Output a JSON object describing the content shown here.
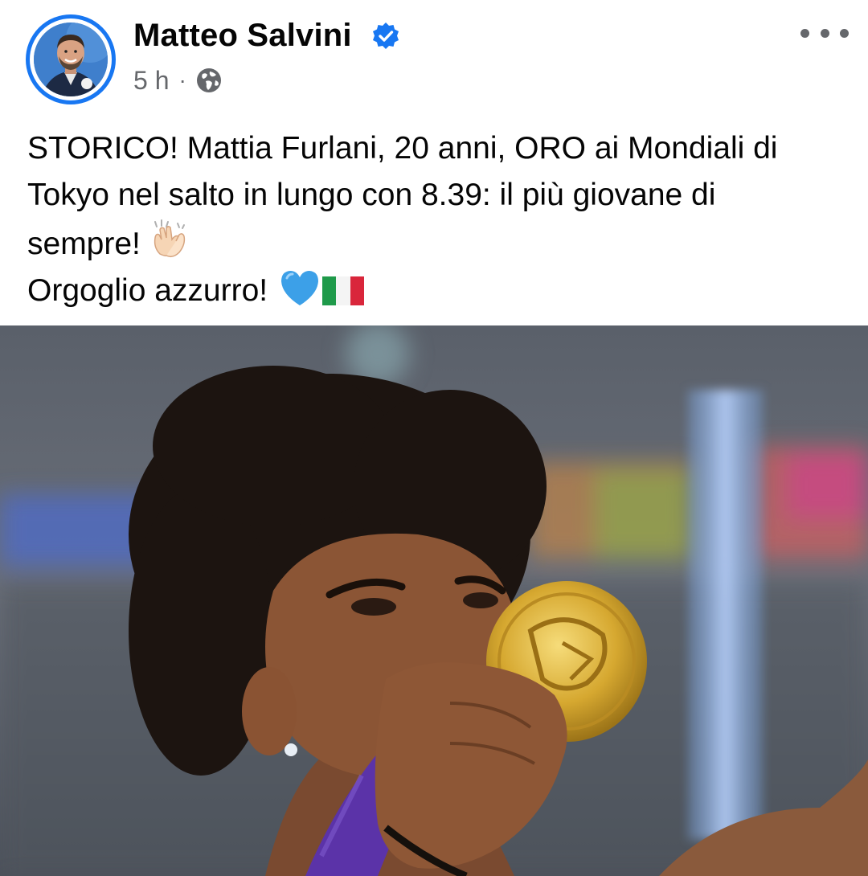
{
  "post": {
    "author": "Matteo Salvini",
    "timestamp": "5 h",
    "separator": "·",
    "privacy_icon": "globe-icon",
    "verified_icon": "verified-badge-icon",
    "more_icon": "more-options-icon",
    "text_lines": [
      "STORICO! Mattia Furlani, 20 anni, ORO ai Mondiali di",
      "Tokyo nel salto in lungo con 8.39: il più giovane di",
      "sempre!",
      "Orgoglio azzurro!"
    ],
    "emojis": {
      "clapping": "clapping-hands-icon",
      "heart": "blue-heart-icon",
      "flag": "italy-flag-icon"
    },
    "photo_subject": "athlete-kissing-gold-medal-photo"
  },
  "colors": {
    "accent": "#1877f2",
    "text": "#050505",
    "meta": "#65676b",
    "medal_gold": "#d4a62a",
    "ribbon_purple": "#5b33a8"
  }
}
